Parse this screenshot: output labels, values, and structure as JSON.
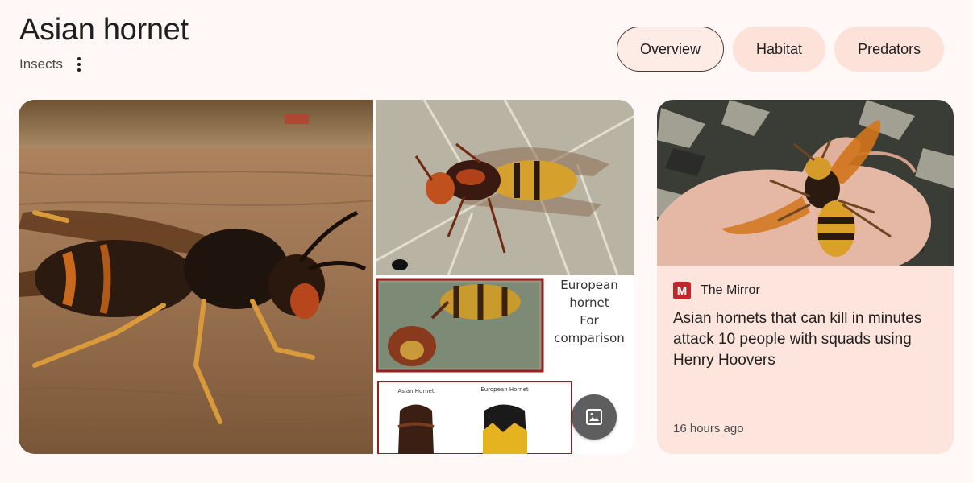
{
  "header": {
    "title": "Asian hornet",
    "subtitle": "Insects",
    "more_options_icon": "more-vert-icon"
  },
  "tabs": [
    {
      "label": "Overview",
      "active": true
    },
    {
      "label": "Habitat",
      "active": false
    },
    {
      "label": "Predators",
      "active": false
    }
  ],
  "images": {
    "comparison_text": [
      "European",
      "hornet",
      "For",
      "comparison"
    ],
    "comparison_small_labels": [
      "Asian Hornet",
      "European Hornet"
    ],
    "view_images_icon": "image-icon"
  },
  "news_card": {
    "source_logo": "M",
    "source": "The Mirror",
    "headline": "Asian hornets that can kill in minutes attack 10 people with squads using Henry Hoovers",
    "time": "16 hours ago"
  },
  "colors": {
    "background": "#fff8f6",
    "chip": "#fde2da",
    "card": "#fde4dc",
    "mirror_red": "#c0262b"
  }
}
